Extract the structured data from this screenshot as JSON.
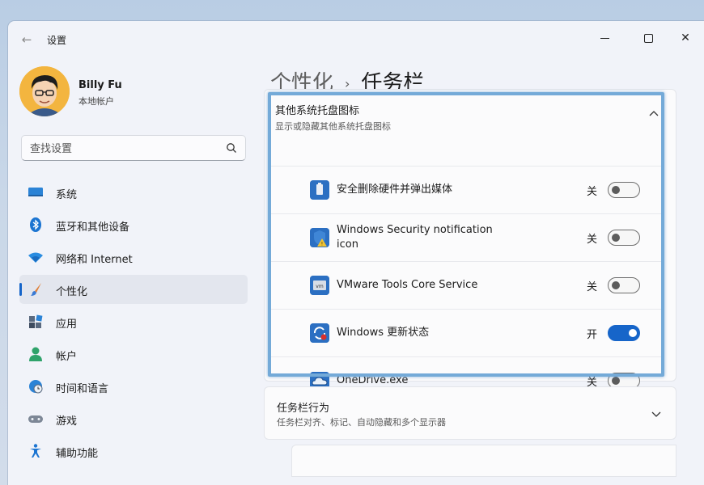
{
  "window": {
    "title": "设置",
    "back_icon": "back-arrow-icon",
    "controls": [
      "minimize-icon",
      "maximize-icon",
      "close-icon"
    ]
  },
  "profile": {
    "name": "Billy Fu",
    "account_type": "本地帐户"
  },
  "search": {
    "placeholder": "查找设置"
  },
  "nav": {
    "items": [
      {
        "label": "系统",
        "icon": "system-icon"
      },
      {
        "label": "蓝牙和其他设备",
        "icon": "bluetooth-icon"
      },
      {
        "label": "网络和 Internet",
        "icon": "wifi-icon"
      },
      {
        "label": "个性化",
        "icon": "brush-icon",
        "active": true
      },
      {
        "label": "应用",
        "icon": "apps-icon"
      },
      {
        "label": "帐户",
        "icon": "account-icon"
      },
      {
        "label": "时间和语言",
        "icon": "globe-clock-icon"
      },
      {
        "label": "游戏",
        "icon": "gamepad-icon"
      },
      {
        "label": "辅助功能",
        "icon": "accessibility-icon"
      }
    ]
  },
  "breadcrumb": {
    "parent": "个性化",
    "separator": "›",
    "current": "任务栏"
  },
  "tray_section": {
    "title": "其他系统托盘图标",
    "description": "显示或隐藏其他系统托盘图标",
    "rows": [
      {
        "label": "安全删除硬件并弹出媒体",
        "state": "关",
        "on": false,
        "icon": "usb-eject-icon"
      },
      {
        "label": "Windows Security notification icon",
        "state": "关",
        "on": false,
        "icon": "security-shield-icon"
      },
      {
        "label": "VMware Tools Core Service",
        "state": "关",
        "on": false,
        "icon": "vmware-icon"
      },
      {
        "label": "Windows 更新状态",
        "state": "开",
        "on": true,
        "icon": "windows-update-icon"
      },
      {
        "label": "OneDrive.exe",
        "state": "关",
        "on": false,
        "icon": "onedrive-cloud-icon"
      }
    ]
  },
  "behavior_section": {
    "title": "任务栏行为",
    "description": "任务栏对齐、标记、自动隐藏和多个显示器"
  },
  "colors": {
    "accent": "#1665c9",
    "highlight_border": "#74aad8"
  }
}
